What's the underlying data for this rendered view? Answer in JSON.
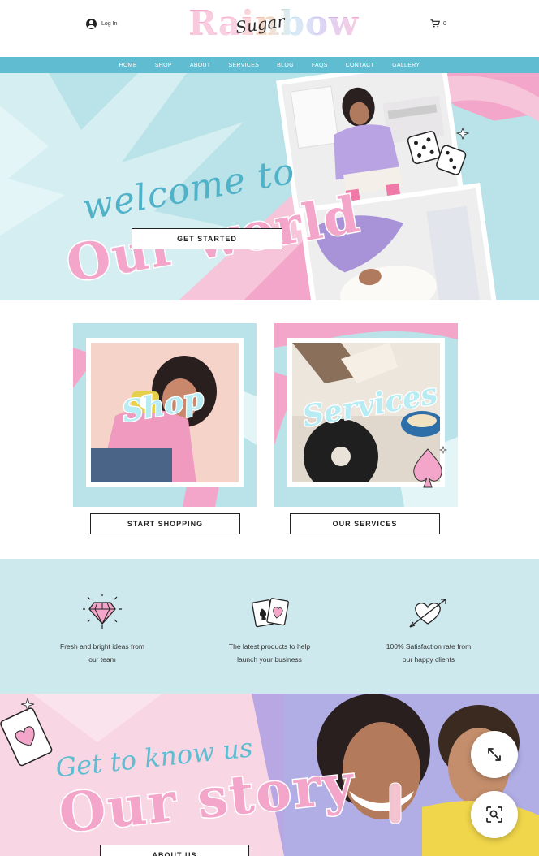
{
  "header": {
    "login_label": "Log In",
    "logo_main": "Rainbow",
    "logo_script": "Sugar",
    "cart_count": "0"
  },
  "nav": [
    "HOME",
    "SHOP",
    "ABOUT",
    "SERVICES",
    "BLOG",
    "FAQS",
    "CONTACT",
    "GALLERY"
  ],
  "hero": {
    "welcome": "welcome to",
    "world": "Our world",
    "cta": "GET STARTED"
  },
  "cards": {
    "shop_label": "Shop",
    "shop_button": "START SHOPPING",
    "services_label": "Services",
    "services_button": "OUR SERVICES"
  },
  "features": [
    {
      "icon": "diamond-icon",
      "line1": "Fresh and bright ideas from",
      "line2": "our team"
    },
    {
      "icon": "playing-cards-icon",
      "line1": "The latest products to help",
      "line2": "launch your business"
    },
    {
      "icon": "heart-arrow-icon",
      "line1": "100% Satisfaction rate from",
      "line2": "our happy clients"
    }
  ],
  "story": {
    "getto": "Get to know us",
    "ourstory": "Our story",
    "cta": "ABOUT US"
  },
  "colors": {
    "nav": "#5fbcd1",
    "teal_light": "#b9e3e8",
    "pink": "#f3a6c9",
    "features_bg": "#cde9ee"
  }
}
